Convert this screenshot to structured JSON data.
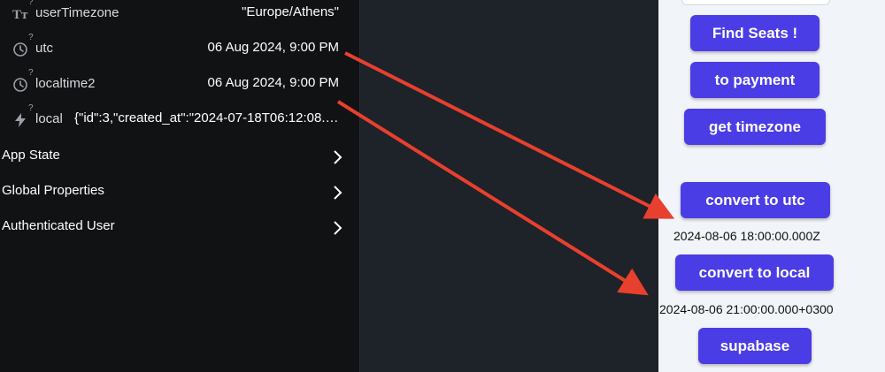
{
  "variables": [
    {
      "name": "userTimezone",
      "value": "\"Europe/Athens\"",
      "icon": "text-type-icon"
    },
    {
      "name": "utc",
      "value": "06 Aug 2024, 9:00 PM",
      "icon": "clock-icon"
    },
    {
      "name": "localtime2",
      "value": "06 Aug 2024, 9:00 PM",
      "icon": "clock-icon"
    },
    {
      "name": "local",
      "value": "{\"id\":3,\"created_at\":\"2024-07-18T06:12:08.71…",
      "icon": "bolt-icon"
    }
  ],
  "help_marker": "?",
  "sections": [
    {
      "label": "App State"
    },
    {
      "label": "Global Properties"
    },
    {
      "label": "Authenticated User"
    }
  ],
  "buttons": {
    "find_seats": "Find Seats !",
    "to_payment": "to payment",
    "get_timezone": "get timezone",
    "convert_utc": "convert to utc",
    "convert_local": "convert to local",
    "supabase": "supabase"
  },
  "results": {
    "utc": "2024-08-06 18:00:00.000Z",
    "local": "2024-08-06 21:00:00.000+0300"
  },
  "colors": {
    "button": "#4b3de5",
    "arrow": "#e8402e",
    "panel_dark": "#111214",
    "canvas": "#f1f4f8"
  }
}
